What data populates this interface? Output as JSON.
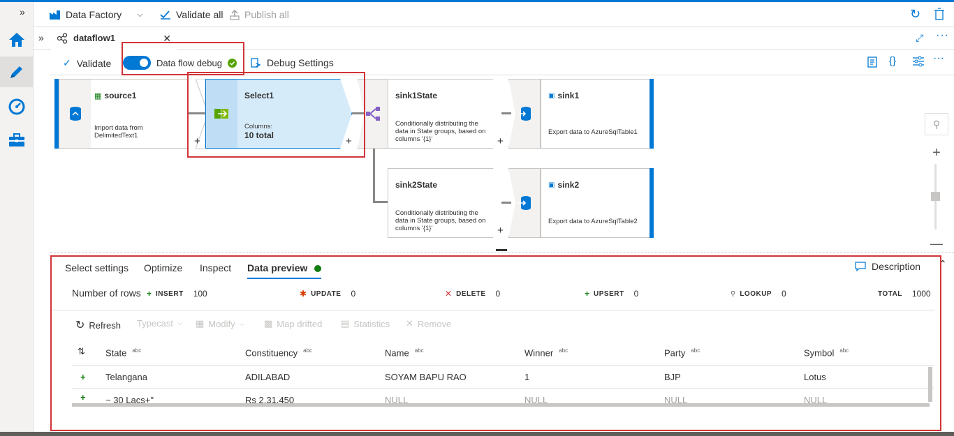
{
  "topbar": {
    "factory_label": "Data Factory",
    "validate_all_label": "Validate all",
    "publish_all_label": "Publish all"
  },
  "tab": {
    "name": "dataflow1"
  },
  "commands": {
    "validate_label": "Validate",
    "debug_label": "Data flow debug",
    "debug_settings_label": "Debug Settings"
  },
  "nodes": {
    "source1": {
      "title": "source1",
      "desc1": "Import data from",
      "desc2": "DelimitedText1"
    },
    "select1": {
      "title": "Select1",
      "columns_label": "Columns:",
      "columns_value": "10 total"
    },
    "sink1state": {
      "title": "sink1State",
      "desc1": "Conditionally distributing the",
      "desc2": "data in State groups, based on",
      "desc3": "columns '{1}'"
    },
    "sink1": {
      "title": "sink1",
      "desc1": "Export data to AzureSqlTable1"
    },
    "sink2state": {
      "title": "sink2State",
      "desc1": "Conditionally distributing the",
      "desc2": "data in State groups, based on",
      "desc3": "columns '{1}'"
    },
    "sink2": {
      "title": "sink2",
      "desc1": "Export data to AzureSqlTable2"
    }
  },
  "panel": {
    "tabs": [
      "Select settings",
      "Optimize",
      "Inspect",
      "Data preview"
    ],
    "description_label": "Description",
    "number_of_rows_label": "Number of rows",
    "stats": {
      "insert_label": "INSERT",
      "insert_value": "100",
      "update_label": "UPDATE",
      "update_value": "0",
      "delete_label": "DELETE",
      "delete_value": "0",
      "upsert_label": "UPSERT",
      "upsert_value": "0",
      "lookup_label": "LOOKUP",
      "lookup_value": "0",
      "total_label": "TOTAL",
      "total_value": "1000"
    },
    "tools": {
      "refresh": "Refresh",
      "typecast": "Typecast",
      "modify": "Modify",
      "map_drifted": "Map drifted",
      "statistics": "Statistics",
      "remove": "Remove"
    },
    "type_tag": "abc",
    "columns": [
      "State",
      "Constituency",
      "Name",
      "Winner",
      "Party",
      "Symbol"
    ],
    "rows": [
      [
        "Telangana",
        "ADILABAD",
        "SOYAM BAPU RAO",
        "1",
        "BJP",
        "Lotus"
      ],
      [
        "~ 30 Lacs+\"",
        "Rs 2,31,450",
        "NULL",
        "NULL",
        "NULL",
        "NULL"
      ]
    ]
  },
  "colors": {
    "accent": "#0078d4",
    "highlight": "#d13438",
    "insert_green": "#107c10"
  }
}
